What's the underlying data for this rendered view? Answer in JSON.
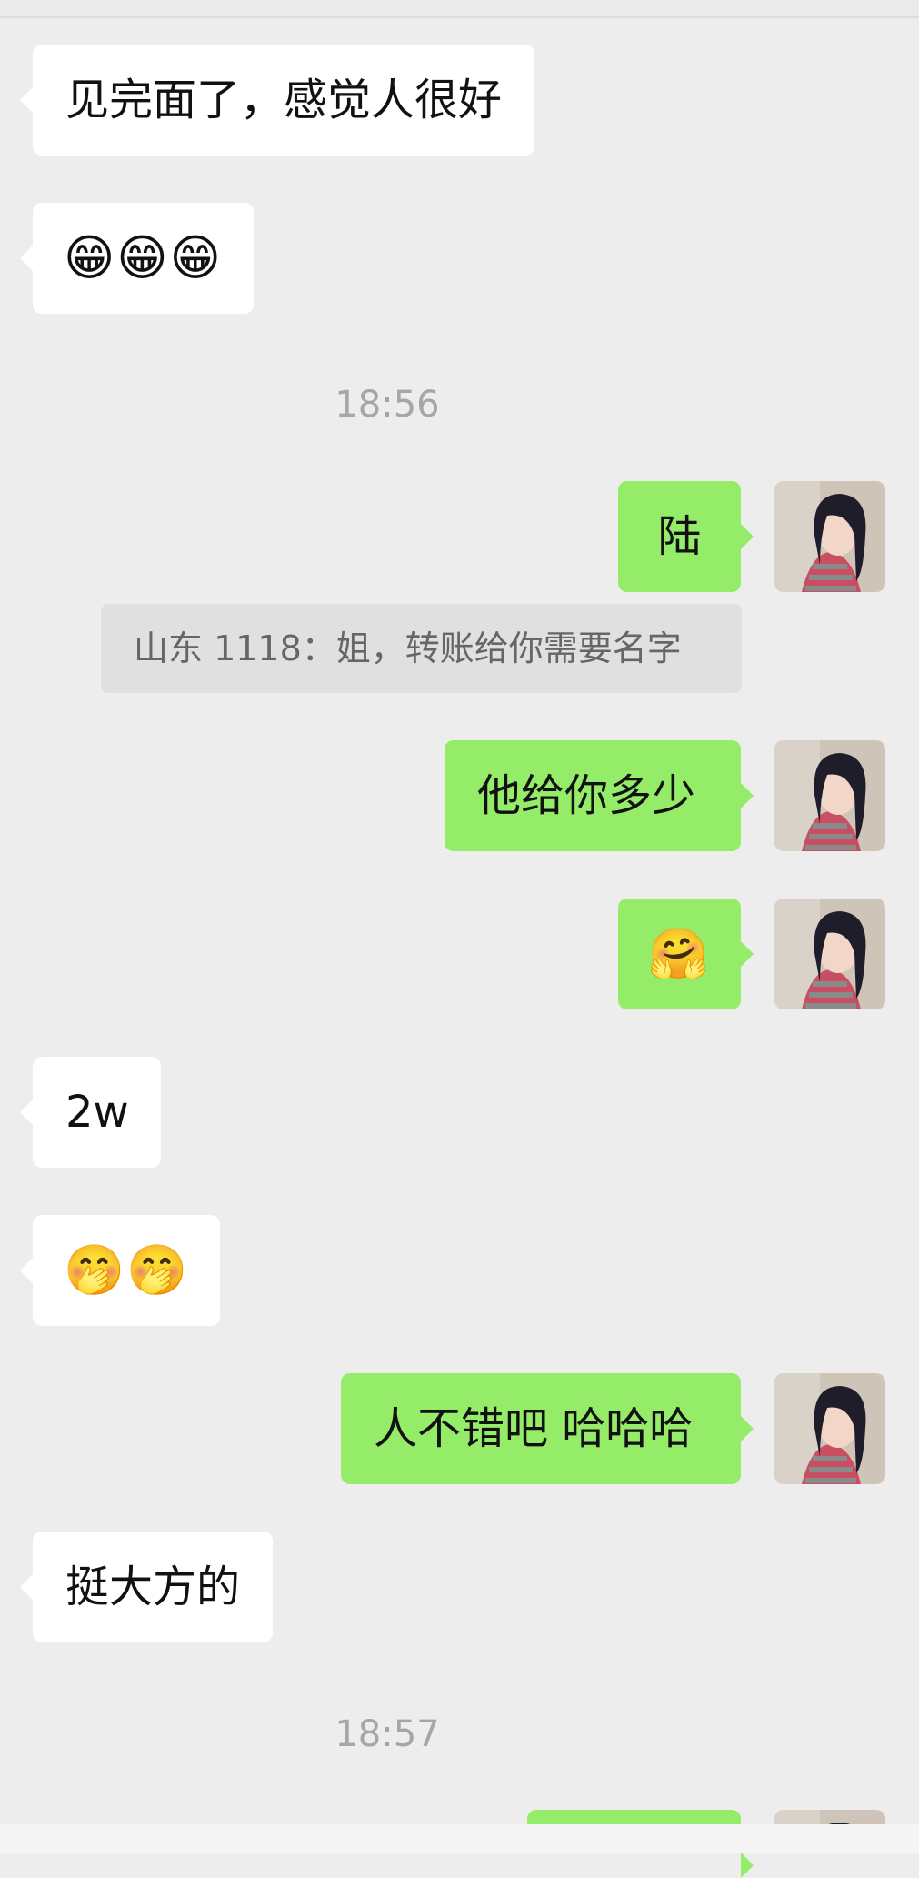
{
  "messages": [
    {
      "side": "left",
      "text": "见完面了，感觉人很好"
    },
    {
      "side": "left",
      "text": "😁😁😁"
    },
    {
      "type": "time",
      "text": "18:56"
    },
    {
      "side": "right",
      "text": "陆"
    },
    {
      "type": "quote",
      "text": "山东 1118：姐，转账给你需要名字"
    },
    {
      "side": "right",
      "text": "他给你多少"
    },
    {
      "side": "right",
      "text": "🤗"
    },
    {
      "side": "left",
      "text": "2w"
    },
    {
      "side": "left",
      "text": "🤭🤭"
    },
    {
      "side": "right",
      "text": "人不错吧 哈哈哈"
    },
    {
      "side": "left",
      "text": "挺大方的"
    },
    {
      "type": "time",
      "text": "18:57"
    }
  ],
  "avatar_icon": "user-avatar-photo",
  "colors": {
    "background": "#ededed",
    "bubble_left": "#ffffff",
    "bubble_right": "#95ec69",
    "timestamp": "#a6a6a6"
  }
}
